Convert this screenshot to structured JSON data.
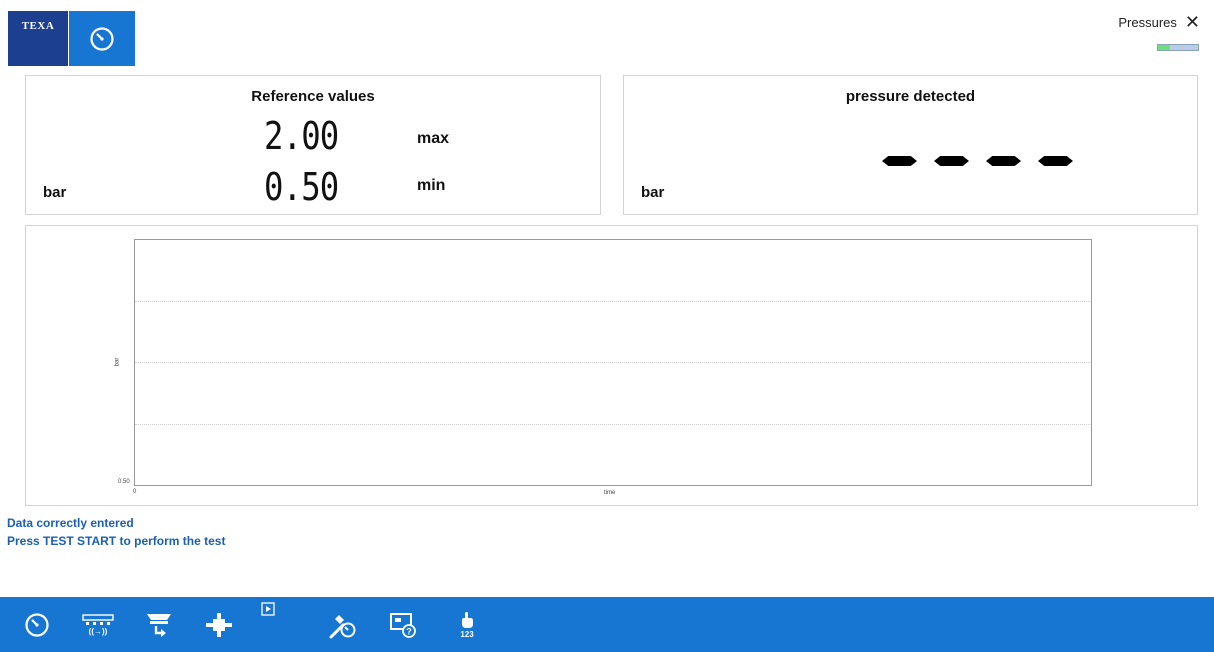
{
  "header": {
    "brand": "TEXA",
    "app_icon": "gauge-icon",
    "title": "Pressures",
    "close_icon": "close-icon",
    "progress_fraction": 0.3
  },
  "reference_panel": {
    "title": "Reference values",
    "max_value": "2.00",
    "max_label": "max",
    "min_value": "0.50",
    "min_label": "min",
    "unit": "bar"
  },
  "detected_panel": {
    "title": "pressure detected",
    "unit": "bar"
  },
  "chart": {
    "ylabel": "bar",
    "xlabel": "time",
    "y_min_label": "0.50",
    "x_min_label": "0"
  },
  "messages": {
    "line1": "Data correctly entered",
    "line2": "Press TEST START to perform the test"
  },
  "toolbar": {
    "items": [
      {
        "icon": "gauge-icon"
      },
      {
        "icon": "communication-icon",
        "label": "((→))"
      },
      {
        "icon": "component-arrow-icon"
      },
      {
        "icon": "actuator-icon"
      },
      {
        "icon": "play-small-icon"
      },
      {
        "icon": "wrench-gauge-icon"
      },
      {
        "icon": "info-panel-icon"
      },
      {
        "icon": "touch-hand-icon",
        "label": "123"
      }
    ]
  }
}
